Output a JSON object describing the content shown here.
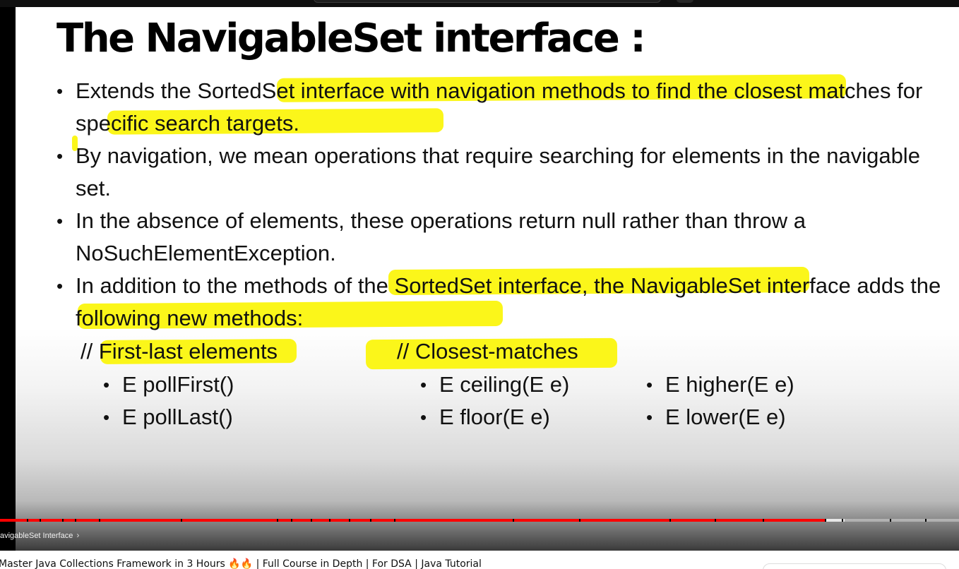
{
  "slide": {
    "title": "The NavigableSet interface :",
    "bullets": [
      "Extends the SortedSet interface with navigation methods to find the closest matches for specific search targets.",
      "By navigation, we mean operations that require searching for elements in the navigable set.",
      "In the absence of elements, these operations return null rather than throw a NoSuchElementException.",
      "In addition to the methods of the SortedSet interface, the NavigableSet interface adds the following new methods:"
    ],
    "first_last_heading": "// First-last elements",
    "first_last_methods": [
      "E pollFirst()",
      "E pollLast()"
    ],
    "closest_heading": "// Closest-matches",
    "closest_methods_left": [
      "E ceiling(E e)",
      "E floor(E e)"
    ],
    "closest_methods_right": [
      "E higher(E e)",
      "E lower(E e)"
    ],
    "highlight_color": "#fbf61a"
  },
  "player": {
    "chapter_label": "avigableSet Interface",
    "chapter_chevron": "›",
    "progress_fraction": 0.861,
    "progress_color": "#ff0000"
  },
  "video": {
    "title": "Master Java Collections Framework in 3 Hours 🔥🔥 | Full Course in Depth | For DSA | Java Tutorial"
  }
}
